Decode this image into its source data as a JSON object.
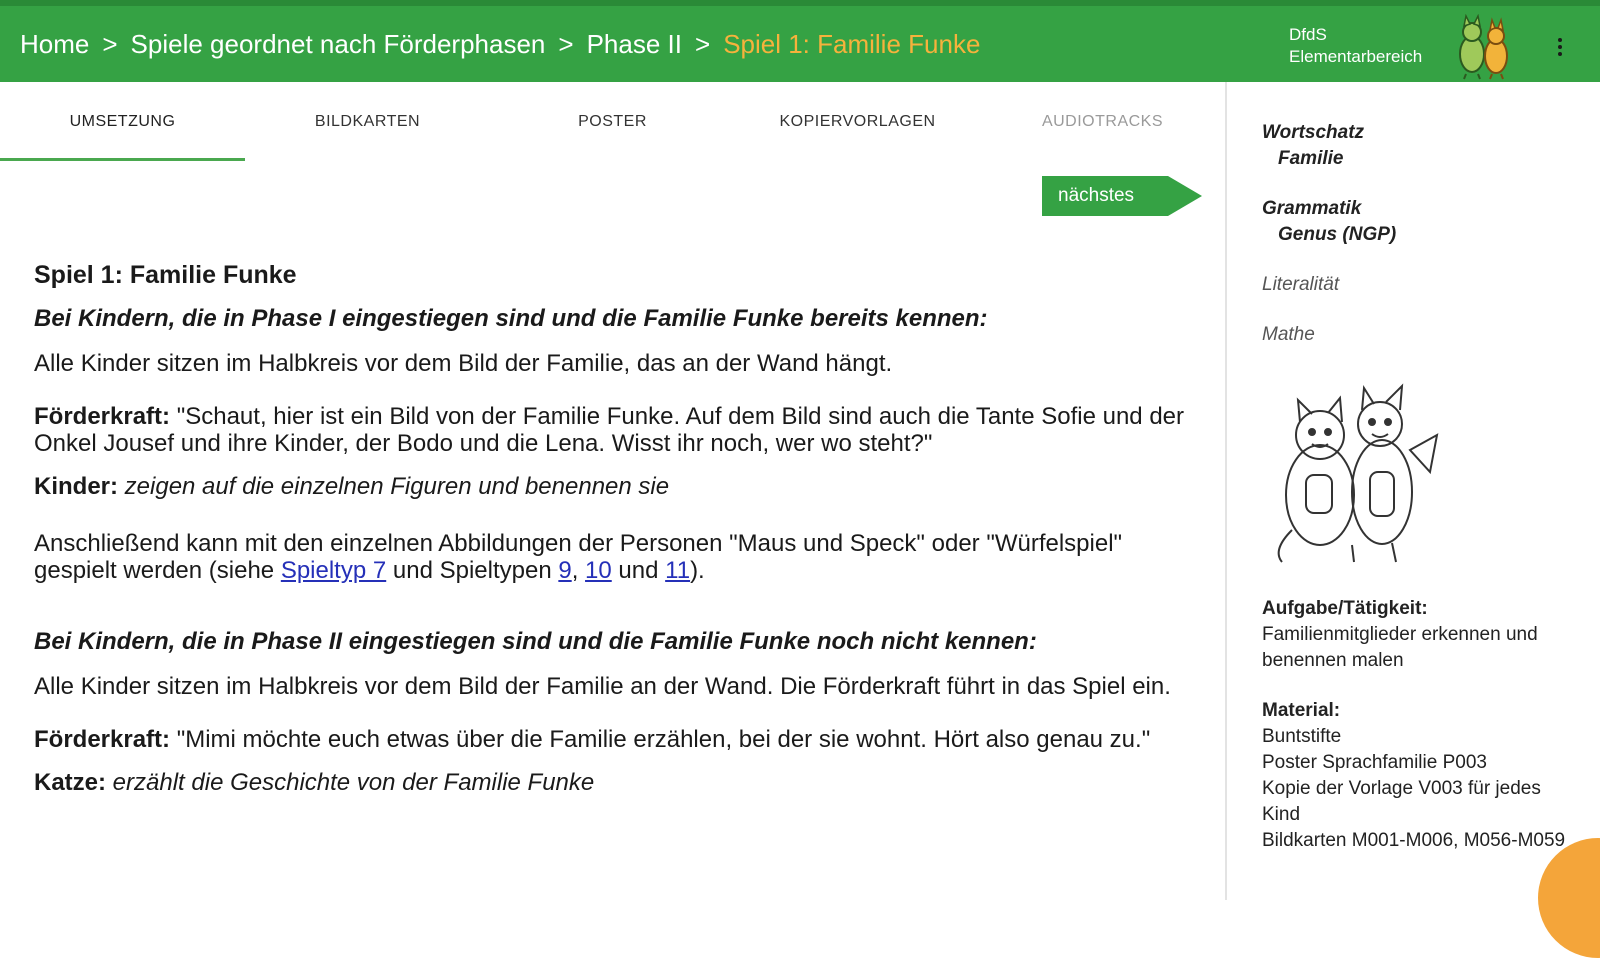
{
  "breadcrumb": {
    "items": [
      "Home",
      "Spiele geordnet nach Förderphasen",
      "Phase II"
    ],
    "current": "Spiel 1: Familie Funke",
    "separator": ">"
  },
  "brand": {
    "line1": "DfdS",
    "line2": "Elementarbereich"
  },
  "tabs": [
    {
      "label": "UMSETZUNG",
      "state": "active"
    },
    {
      "label": "BILDKARTEN"
    },
    {
      "label": "POSTER"
    },
    {
      "label": "KOPIERVORLAGEN"
    },
    {
      "label": "AUDIOTRACKS",
      "state": "disabled"
    }
  ],
  "next_button": {
    "label": "nächstes"
  },
  "content": {
    "title": "Spiel 1: Familie Funke",
    "section1_heading": "Bei Kindern, die in Phase I eingestiegen sind und die Familie Funke bereits kennen:",
    "section1_text": "Alle Kinder sitzen im Halbkreis vor dem Bild der Familie, das an der Wand hängt.",
    "dialog1_speaker": "Förderkraft:",
    "dialog1_text": " \"Schaut, hier ist ein Bild von der Familie Funke. Auf dem Bild sind auch die Tante Sofie und der Onkel Jousef und ihre Kinder, der Bodo und die Lena. Wisst ihr noch, wer wo steht?\"",
    "dialog2_speaker": "Kinder:",
    "dialog2_text": " zeigen auf die einzelnen Figuren und benennen sie",
    "follow_text_a": "Anschließend kann mit den einzelnen Abbildungen der Personen \"Maus und Speck\" oder \"Würfelspiel\" gespielt werden (siehe ",
    "link_spieltyp7": "Spieltyp 7",
    "follow_text_b": " und Spieltypen ",
    "link_9": "9",
    "comma": ", ",
    "link_10": "10",
    "und": " und ",
    "link_11": "11",
    "close": ").",
    "section2_heading": "Bei Kindern, die in Phase II eingestiegen sind und die Familie Funke noch nicht kennen:",
    "section2_text": "Alle Kinder sitzen im Halbkreis vor dem Bild der Familie an der Wand. Die Förderkraft führt in das Spiel ein.",
    "dialog3_speaker": "Förderkraft:",
    "dialog3_text": " \"Mimi möchte euch etwas über die Familie erzählen, bei der sie wohnt. Hört also genau zu.\"",
    "dialog4_speaker": "Katze:",
    "dialog4_text": " erzählt die Geschichte von der Familie Funke"
  },
  "sidebar": {
    "wortschatz_label": "Wortschatz",
    "wortschatz_value": "Familie",
    "grammatik_label": "Grammatik",
    "grammatik_value": "Genus (NGP)",
    "literalitaet": "Literalität",
    "mathe": "Mathe",
    "aufgabe_label": "Aufgabe/Tätigkeit:",
    "aufgabe_value": "Familienmitglieder erkennen und benennen malen",
    "material_label": "Material:",
    "material_items": [
      "Buntstifte",
      "Poster Sprachfamilie P003",
      "Kopie der Vorlage V003 für jedes Kind",
      "Bildkarten M001-M006, M056-M059"
    ]
  },
  "icons": [
    "cat-mascot-icon",
    "kebab-menu-icon",
    "cats-illustration"
  ],
  "colors": {
    "primary_green": "#35a244",
    "breadcrumb_current": "#f6b23c",
    "link": "#2530b8",
    "accent_orange": "#f4a53a"
  }
}
